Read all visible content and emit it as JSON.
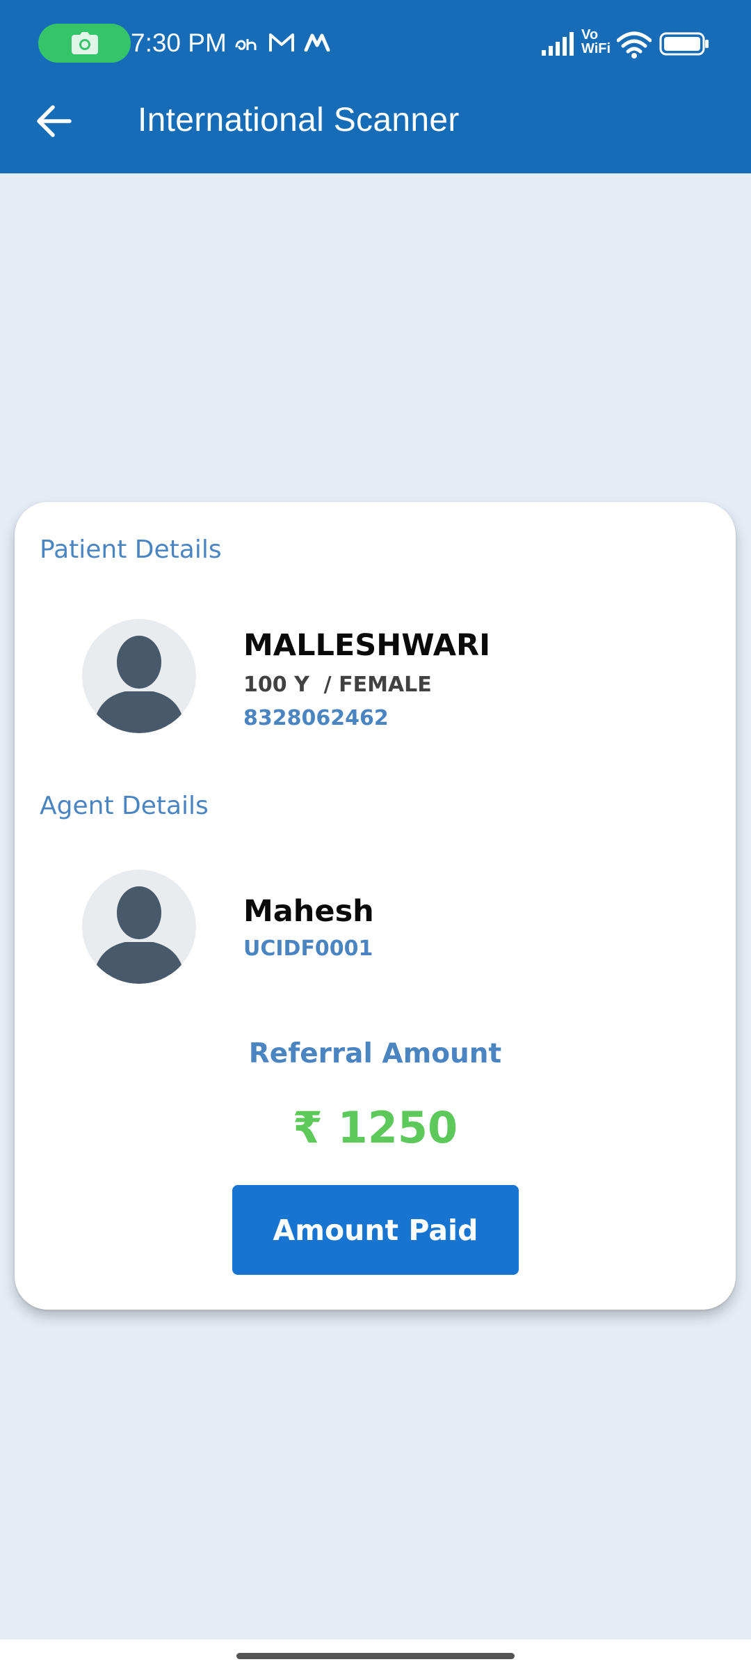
{
  "status_bar": {
    "time": "7:30 PM",
    "signal_icon": "signal-bars-icon",
    "vowifi_label": "Vo WiFi",
    "wifi_icon": "wifi-icon",
    "battery_icon": "battery-icon"
  },
  "app_bar": {
    "title": "International Scanner",
    "back_icon": "arrow-left-icon",
    "color": "#176cb8"
  },
  "card": {
    "patient_section_title": "Patient Details",
    "patient": {
      "name": "MALLESHWARI",
      "age_gender": "100 Y  / FEMALE",
      "phone": "8328062462"
    },
    "agent_section_title": "Agent Details",
    "agent": {
      "name": "Mahesh",
      "id": "UCIDF0001"
    },
    "referral_label": "Referral Amount",
    "referral_amount": "₹ 1250",
    "pay_button_label": "Amount Paid"
  },
  "colors": {
    "accent": "#4a84c1",
    "amount": "#5cc95a",
    "button": "#1775d1",
    "background": "#e5ecf5"
  }
}
